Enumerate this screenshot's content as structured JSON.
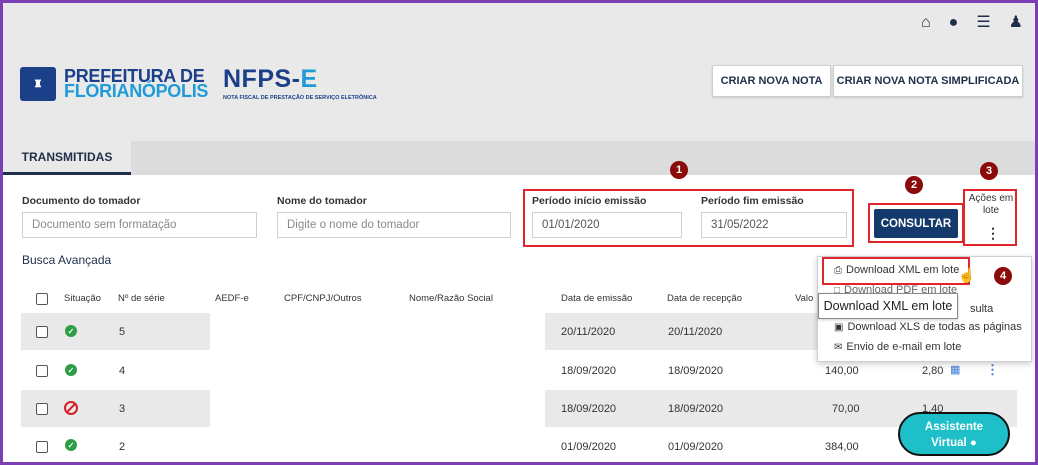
{
  "header": {
    "icons": [
      "home-icon",
      "globe-icon",
      "menu-icon",
      "user-icon"
    ],
    "logo_line1": "PREFEITURA DE",
    "logo_line2": "FLORIANÓPOLIS",
    "app_title_main": "NFPS-",
    "app_title_accent": "E",
    "app_subtitle": "NOTA FISCAL DE PRESTAÇÃO DE SERVIÇO ELETRÔNICA",
    "btn_new": "CRIAR NOVA NOTA",
    "btn_new_simple": "CRIAR NOVA NOTA SIMPLIFICADA"
  },
  "tabs": {
    "active": "TRANSMITIDAS"
  },
  "filters": {
    "doc_label": "Documento do tomador",
    "doc_placeholder": "Documento sem formatação",
    "name_label": "Nome do tomador",
    "name_placeholder": "Digite o nome do tomador",
    "start_label": "Período início emissão",
    "start_value": "01/01/2020",
    "end_label": "Período fim emissão",
    "end_value": "31/05/2022",
    "consultar": "CONSULTAR",
    "acoes_line1": "Ações em",
    "acoes_line2": "lote",
    "busca": "Busca Avançada"
  },
  "badges": [
    "1",
    "2",
    "3",
    "4"
  ],
  "table": {
    "headers": [
      "Situação",
      "Nº de série",
      "AEDF-e",
      "CPF/CNPJ/Outros",
      "Nome/Razão Social",
      "Data de emissão",
      "Data de recepção",
      "Valo"
    ],
    "rows": [
      {
        "status": "ok",
        "serie": "5",
        "emissao": "20/11/2020",
        "recepcao": "20/11/2020",
        "valor": "",
        "iss": ""
      },
      {
        "status": "ok",
        "serie": "4",
        "emissao": "18/09/2020",
        "recepcao": "18/09/2020",
        "valor": "140,00",
        "iss": "2,80"
      },
      {
        "status": "cancelled",
        "serie": "3",
        "emissao": "18/09/2020",
        "recepcao": "18/09/2020",
        "valor": "70,00",
        "iss": "1,40"
      },
      {
        "status": "ok",
        "serie": "2",
        "emissao": "01/09/2020",
        "recepcao": "01/09/2020",
        "valor": "384,00",
        "iss": ""
      }
    ]
  },
  "dropdown": {
    "xml": "Download XML em lote",
    "pdf": "Download PDF em lote",
    "consulta_suffix": "sulta",
    "xls": "Download XLS de todas as páginas",
    "email": "Envio de e-mail em lote"
  },
  "tooltip": "Download XML em lote",
  "assistant": {
    "line1": "Assistente",
    "line2": "Virtual"
  },
  "colors": {
    "primary": "#143a6b",
    "accent": "#1f9bd8",
    "highlight": "#e0262b",
    "badge": "#8b0a0a",
    "assistant": "#1ebfc9"
  }
}
